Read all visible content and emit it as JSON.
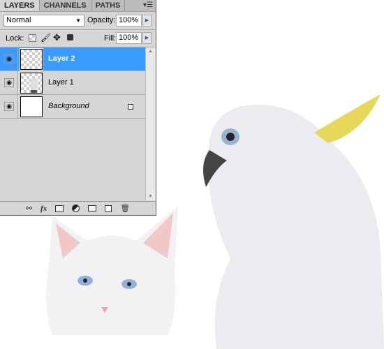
{
  "tabs": [
    {
      "label": "LAYERS",
      "active": true
    },
    {
      "label": "CHANNELS",
      "active": false
    },
    {
      "label": "PATHS",
      "active": false
    }
  ],
  "panel_menu_icon": "panel-menu-icon",
  "blend_mode": "Normal",
  "opacity_label": "Opacity:",
  "opacity_value": "100%",
  "lock_label": "Lock:",
  "fill_label": "Fill:",
  "fill_value": "100%",
  "layers": [
    {
      "name": "Layer 2",
      "selected": true,
      "visible": true
    },
    {
      "name": "Layer 1",
      "selected": false,
      "visible": true
    },
    {
      "name": "Background",
      "selected": false,
      "visible": true,
      "locked": true
    }
  ],
  "bottom_icons": [
    "link-icon",
    "fx-icon",
    "mask-icon",
    "adjustment-icon",
    "folder-icon",
    "new-layer-icon",
    "trash-icon"
  ],
  "colors": {
    "selection": "#3a9bff",
    "panel": "#d6d6d6"
  }
}
